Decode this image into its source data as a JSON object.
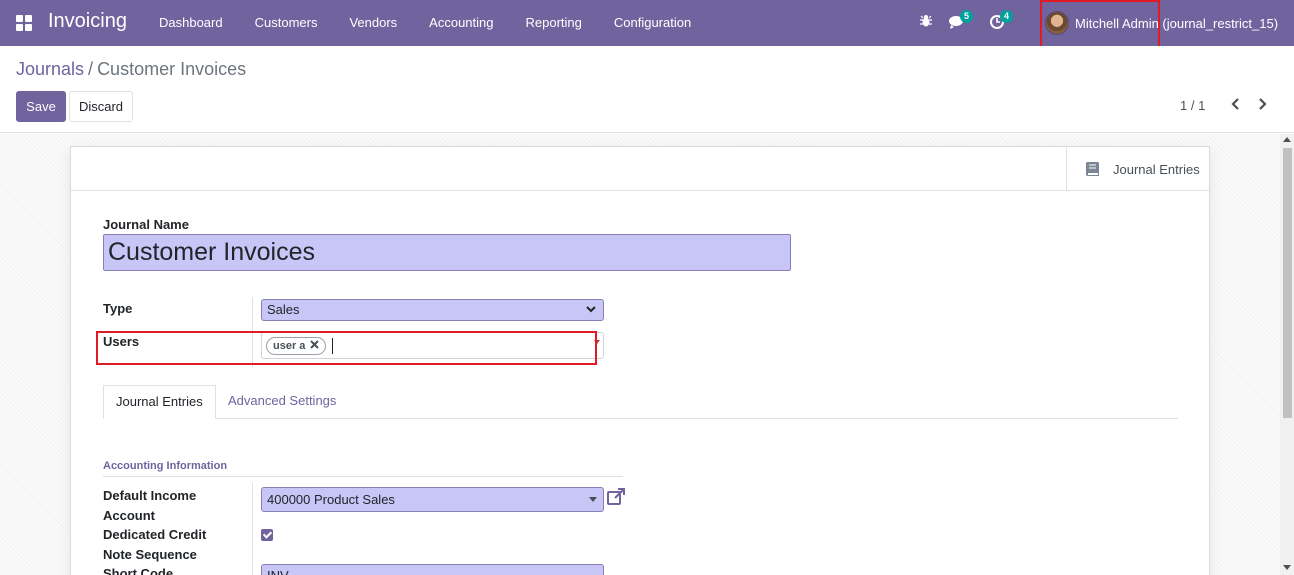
{
  "navbar": {
    "app_title": "Invoicing",
    "menu": [
      "Dashboard",
      "Customers",
      "Vendors",
      "Accounting",
      "Reporting",
      "Configuration"
    ],
    "messages_count": "5",
    "activities_count": "4",
    "user_name": "Mitchell Admin (journal_restrict_15)"
  },
  "breadcrumb": {
    "parent": "Journals",
    "separator": "/",
    "current": "Customer Invoices"
  },
  "toolbar": {
    "save_label": "Save",
    "discard_label": "Discard",
    "pager": "1 / 1"
  },
  "smart_button": {
    "label": "Journal Entries"
  },
  "form": {
    "journal_name_label": "Journal Name",
    "journal_name_value": "Customer Invoices",
    "type_label": "Type",
    "type_value": "Sales",
    "users_label": "Users",
    "users_tag": "user a"
  },
  "tabs": [
    "Journal Entries",
    "Advanced Settings"
  ],
  "accounting": {
    "section_title": "Accounting Information",
    "default_income_label_1": "Default Income",
    "default_income_label_2": "Account",
    "default_income_value": "400000 Product Sales",
    "dedicated_credit_label_1": "Dedicated Credit",
    "dedicated_credit_label_2": "Note Sequence",
    "dedicated_credit_checked": true,
    "short_code_label": "Short Code",
    "short_code_value": "INV"
  },
  "colors": {
    "brand": "#71639e",
    "input_bg": "#c8c5f7",
    "highlight": "#e01b24",
    "badge": "#00a09d"
  }
}
